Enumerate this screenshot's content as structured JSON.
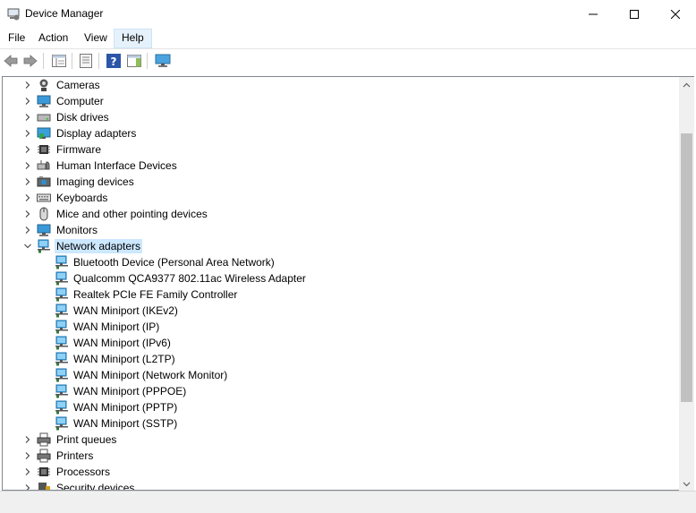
{
  "window": {
    "title": "Device Manager"
  },
  "menu": {
    "items": [
      "File",
      "Action",
      "View",
      "Help"
    ]
  },
  "toolbar": {
    "icons": [
      "back-arrow",
      "forward-arrow",
      "show-hide-console-tree",
      "properties",
      "help",
      "action-pane",
      "monitor"
    ]
  },
  "tree": {
    "categories_top": [
      {
        "label": "Cameras",
        "icon": "camera"
      },
      {
        "label": "Computer",
        "icon": "computer"
      },
      {
        "label": "Disk drives",
        "icon": "disk"
      },
      {
        "label": "Display adapters",
        "icon": "display"
      },
      {
        "label": "Firmware",
        "icon": "chip"
      },
      {
        "label": "Human Interface Devices",
        "icon": "hid"
      },
      {
        "label": "Imaging devices",
        "icon": "imaging"
      },
      {
        "label": "Keyboards",
        "icon": "keyboard"
      },
      {
        "label": "Mice and other pointing devices",
        "icon": "mouse"
      },
      {
        "label": "Monitors",
        "icon": "monitor"
      }
    ],
    "expanded": {
      "label": "Network adapters",
      "icon": "network",
      "children": [
        "Bluetooth Device (Personal Area Network)",
        "Qualcomm QCA9377 802.11ac Wireless Adapter",
        "Realtek PCIe FE Family Controller",
        "WAN Miniport (IKEv2)",
        "WAN Miniport (IP)",
        "WAN Miniport (IPv6)",
        "WAN Miniport (L2TP)",
        "WAN Miniport (Network Monitor)",
        "WAN Miniport (PPPOE)",
        "WAN Miniport (PPTP)",
        "WAN Miniport (SSTP)"
      ]
    },
    "categories_bottom": [
      {
        "label": "Print queues",
        "icon": "printer"
      },
      {
        "label": "Printers",
        "icon": "printer"
      },
      {
        "label": "Processors",
        "icon": "chip"
      },
      {
        "label": "Security devices",
        "icon": "security"
      }
    ]
  },
  "colors": {
    "selection": "#cce8ff",
    "network_icon": "#1e90d6"
  }
}
